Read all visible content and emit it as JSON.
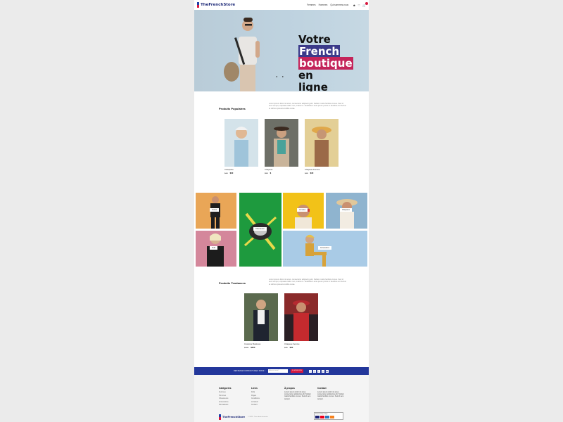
{
  "brand": {
    "name": "TheFrenchStore"
  },
  "nav": {
    "items": [
      "Femmes",
      "Hommes",
      "Qui sommes-nous"
    ]
  },
  "hero": {
    "line1": "Votre",
    "highlight1": "French",
    "highlight2": "boutique",
    "line2b": "en",
    "line3": "ligne"
  },
  "popular": {
    "title": "Produits Populaires",
    "text": "Lorem ipsum dolor sit amet, consectetur adipiscing elit. Nullam mattis facilisis cursus. Sed id sem tempor, vulputate tellus non, mattis mi. Vestibulum ante ipsum primis in faucibus orci luctus et ultrices posuere cubilia curae.",
    "products": [
      {
        "name": "Casquette",
        "old": "$40",
        "price": "$30"
      },
      {
        "name": "Chapeau",
        "old": "$58",
        "price": "$"
      },
      {
        "name": "Chapeau Femme",
        "old": "$45",
        "price": "$30"
      }
    ]
  },
  "categories": [
    "Vestes",
    "Chaussures",
    "Lunettes",
    "Chapeaux",
    "Pulls",
    "Accessoires"
  ],
  "trending": {
    "title": "Produits Tendances",
    "text": "Lorem ipsum dolor sit amet, consectetur adipiscing elit. Nullam mattis facilisis cursus. Sed id sem tempor, vulputate tellus non, mattis mi. Vestibulum ante ipsum primis in faucibus orci luctus et ultrices posuere cubilia curae.",
    "products": [
      {
        "name": "Costume Business",
        "old": "$290",
        "price": "$250"
      },
      {
        "name": "Chapeau Femme",
        "old": "$45",
        "price": "$30"
      }
    ]
  },
  "newsletter": {
    "text": "RESTEZ EN CONTACT AVEC NOUS !",
    "placeholder": "Adresse email",
    "button": "JE M'INSCRIS"
  },
  "footer": {
    "categories": {
      "title": "Catégories",
      "links": [
        "Femmes",
        "Hommes",
        "Chaussures",
        "Accessoires",
        "Nouveautés"
      ]
    },
    "links": {
      "title": "Liens",
      "links": [
        "FAQ",
        "Pages",
        "Conditions",
        "Livraison",
        "Contact"
      ]
    },
    "about": {
      "title": "À propos",
      "text": "Lorem ipsum dolor sit amet, consectetur adipiscing elit. Nullam mattis facilisis cursus. Sed id sem tempor."
    },
    "contact": {
      "title": "Contact",
      "text": "Lorem ipsum dolor sit amet, consectetur adipiscing elit. Nullam mattis facilisis cursus. Sed id sem tempor."
    },
    "copyright": "© 2023 - Tous droits réservés",
    "stripe": "Powered by stripe"
  }
}
